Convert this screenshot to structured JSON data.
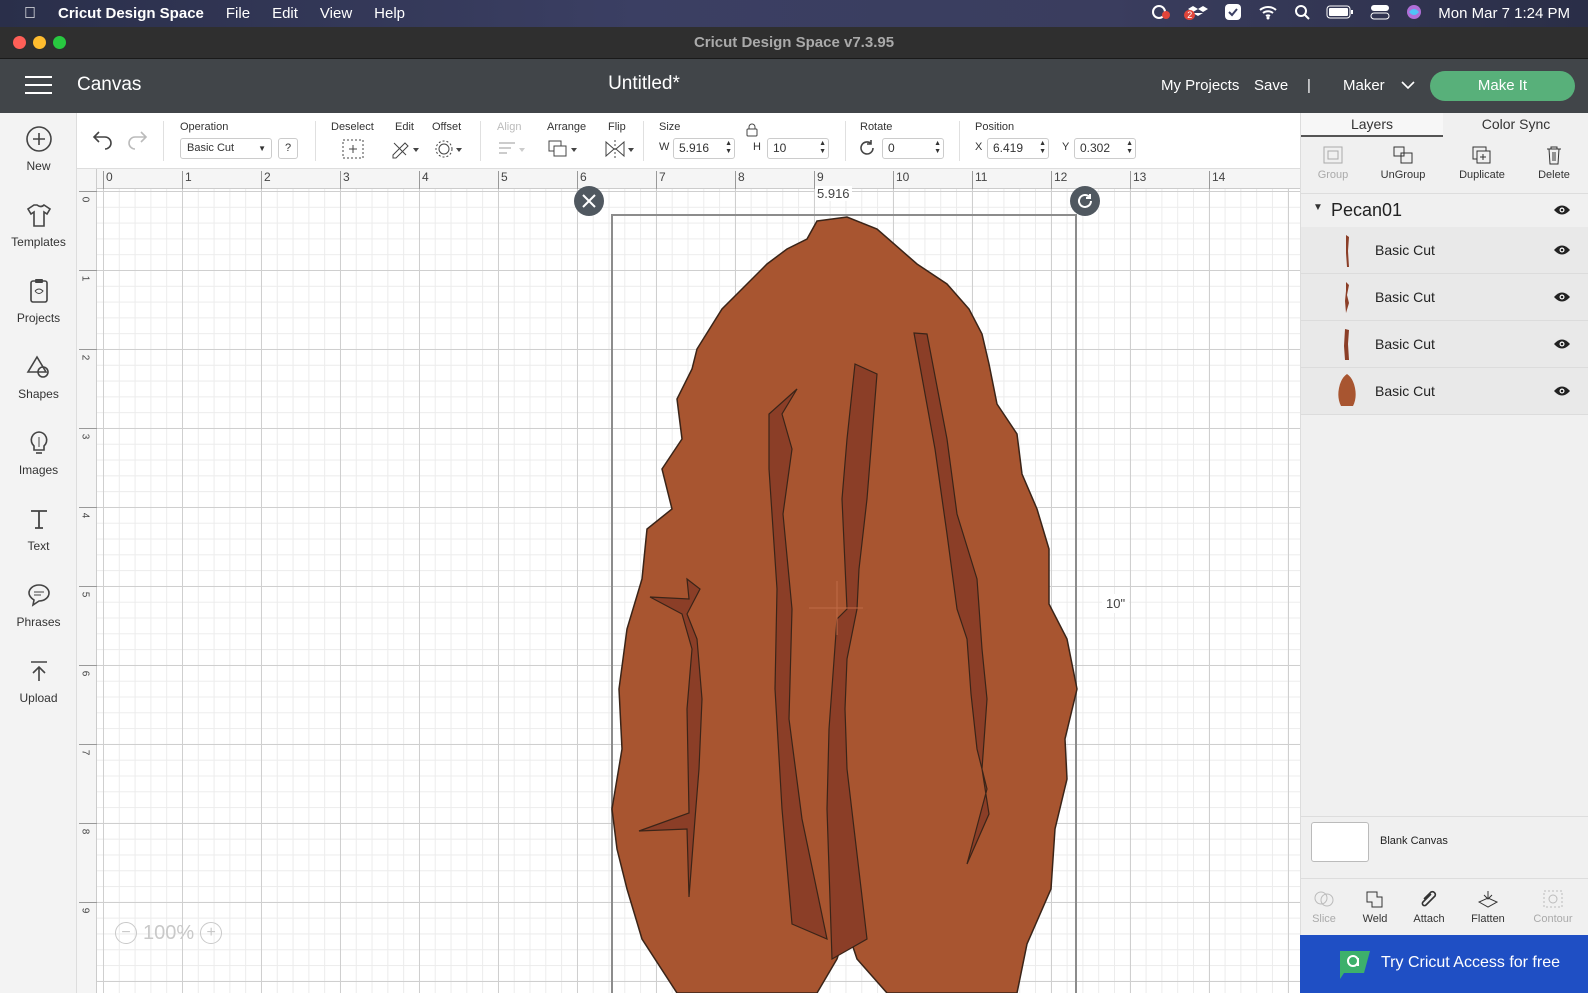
{
  "menubar": {
    "app_name": "Cricut Design Space",
    "menus": [
      "File",
      "Edit",
      "View",
      "Help"
    ],
    "datetime": "Mon Mar 7  1:24 PM",
    "badge_count": "2"
  },
  "window": {
    "title": "Cricut Design Space  v7.3.95"
  },
  "header": {
    "section": "Canvas",
    "doc_title": "Untitled*",
    "my_projects": "My Projects",
    "save": "Save",
    "separator": "|",
    "machine": "Maker",
    "make_it": "Make It"
  },
  "sidebar": {
    "items": [
      {
        "label": "New",
        "icon": "plus-circle-icon"
      },
      {
        "label": "Templates",
        "icon": "shirt-icon"
      },
      {
        "label": "Projects",
        "icon": "clipboard-icon"
      },
      {
        "label": "Shapes",
        "icon": "shapes-icon"
      },
      {
        "label": "Images",
        "icon": "lightbulb-icon"
      },
      {
        "label": "Text",
        "icon": "text-icon"
      },
      {
        "label": "Phrases",
        "icon": "speech-bubble-icon"
      },
      {
        "label": "Upload",
        "icon": "upload-icon"
      }
    ]
  },
  "toolbar": {
    "operation_label": "Operation",
    "operation_value": "Basic Cut",
    "help": "?",
    "deselect": "Deselect",
    "edit": "Edit",
    "offset": "Offset",
    "align": "Align",
    "arrange": "Arrange",
    "flip": "Flip",
    "size": "Size",
    "w_label": "W",
    "w_value": "5.916",
    "h_label": "H",
    "h_value": "10",
    "rotate": "Rotate",
    "rotate_value": "0",
    "position": "Position",
    "x_label": "X",
    "x_value": "6.419",
    "y_label": "Y",
    "y_value": "0.302"
  },
  "canvas": {
    "ruler_top": [
      "0",
      "1",
      "2",
      "3",
      "4",
      "5",
      "6",
      "7",
      "8",
      "9",
      "10",
      "11",
      "12",
      "13",
      "14"
    ],
    "ruler_left": [
      "0",
      "1",
      "2",
      "3",
      "4",
      "5",
      "6",
      "7",
      "8",
      "9"
    ],
    "width_label": "5.916",
    "height_label": "10\"",
    "zoom": "100%",
    "colors": {
      "nut_fill": "#a85530",
      "groove_fill": "#8b3e27",
      "outline": "#3a2418"
    }
  },
  "right_panel": {
    "tabs": [
      "Layers",
      "Color Sync"
    ],
    "actions": [
      "Group",
      "UnGroup",
      "Duplicate",
      "Delete"
    ],
    "group_name": "Pecan01",
    "layers": [
      "Basic Cut",
      "Basic Cut",
      "Basic Cut",
      "Basic Cut"
    ],
    "blank_canvas": "Blank Canvas",
    "bottom_actions": [
      "Slice",
      "Weld",
      "Attach",
      "Flatten",
      "Contour"
    ],
    "try_access": "Try Cricut Access for free"
  }
}
